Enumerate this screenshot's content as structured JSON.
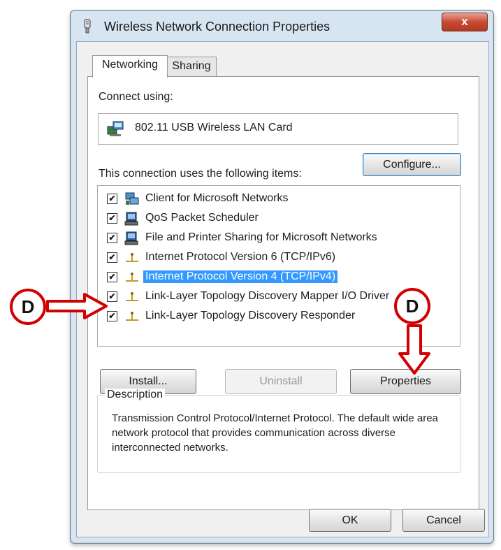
{
  "window": {
    "title": "Wireless Network Connection Properties",
    "close_label": "x"
  },
  "tabs": [
    {
      "label": "Networking",
      "active": true
    },
    {
      "label": "Sharing",
      "active": false
    }
  ],
  "connect_using": {
    "label": "Connect using:",
    "adapter": "802.11 USB Wireless LAN Card"
  },
  "configure_button": "Configure...",
  "items_label": "This connection uses the following items:",
  "items": [
    {
      "label": "Client for Microsoft Networks",
      "checked": true,
      "icon": "network-client-icon"
    },
    {
      "label": "QoS Packet Scheduler",
      "checked": true,
      "icon": "network-service-icon"
    },
    {
      "label": "File and Printer Sharing for Microsoft Networks",
      "checked": true,
      "icon": "network-service-icon"
    },
    {
      "label": "Internet Protocol Version 6 (TCP/IPv6)",
      "checked": true,
      "icon": "protocol-icon"
    },
    {
      "label": "Internet Protocol Version 4 (TCP/IPv4)",
      "checked": true,
      "icon": "protocol-icon",
      "selected": true
    },
    {
      "label": "Link-Layer Topology Discovery Mapper I/O Driver",
      "checked": true,
      "icon": "protocol-icon"
    },
    {
      "label": "Link-Layer Topology Discovery Responder",
      "checked": true,
      "icon": "protocol-icon"
    }
  ],
  "buttons": {
    "install": "Install...",
    "uninstall": "Uninstall",
    "properties": "Properties",
    "ok": "OK",
    "cancel": "Cancel"
  },
  "description": {
    "legend": "Description",
    "text": "Transmission Control Protocol/Internet Protocol. The default wide area network protocol that provides communication across diverse interconnected networks."
  },
  "annotations": {
    "left_marker": "D",
    "right_marker": "D",
    "color": "#d20000"
  },
  "colors": {
    "selection": "#3399ff",
    "frame": "#d7e4f2"
  }
}
